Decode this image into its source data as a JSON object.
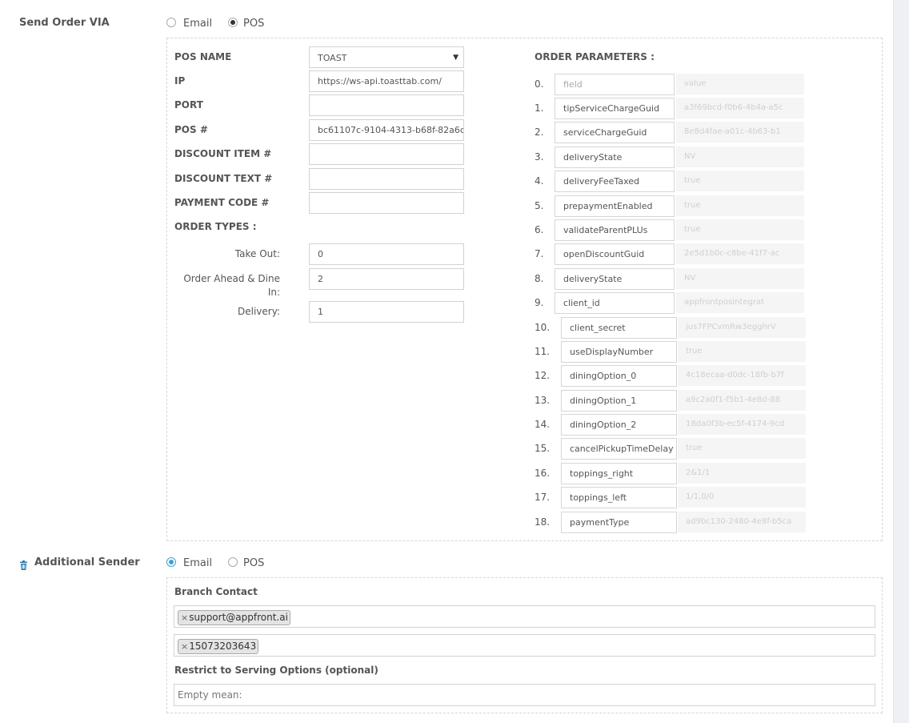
{
  "send_order": {
    "label": "Send Order VIA",
    "options": [
      "Email",
      "POS"
    ],
    "selected": "POS"
  },
  "pos": {
    "name_label": "POS NAME",
    "name_value": "TOAST",
    "ip_label": "IP",
    "ip_value": "https://ws-api.toasttab.com/",
    "port_label": "PORT",
    "port_value": "",
    "posnum_label": "POS #",
    "posnum_value": "bc61107c-9104-4313-b68f-82a6c2",
    "discount_item_label": "DISCOUNT ITEM #",
    "discount_item_value": "",
    "discount_text_label": "DISCOUNT TEXT #",
    "discount_text_value": "",
    "payment_code_label": "PAYMENT CODE #",
    "payment_code_value": ""
  },
  "order_types": {
    "label": "ORDER TYPES :",
    "take_out_label": "Take Out:",
    "take_out_value": "0",
    "order_ahead_label": "Order Ahead & Dine In:",
    "order_ahead_value": "2",
    "delivery_label": "Delivery:",
    "delivery_value": "1"
  },
  "order_parameters": {
    "label": "ORDER PARAMETERS :",
    "items": [
      {
        "num": "0.",
        "key": "field",
        "placeholder": true,
        "value": "value"
      },
      {
        "num": "1.",
        "key": "tipServiceChargeGuid",
        "value": "a3f69bcd-f0b6-4b4a-a5c"
      },
      {
        "num": "2.",
        "key": "serviceChargeGuid",
        "value": "8e8d4fae-a01c-4b63-b1"
      },
      {
        "num": "3.",
        "key": "deliveryState",
        "value": "NV"
      },
      {
        "num": "4.",
        "key": "deliveryFeeTaxed",
        "value": "true"
      },
      {
        "num": "5.",
        "key": "prepaymentEnabled",
        "value": "true"
      },
      {
        "num": "6.",
        "key": "validateParentPLUs",
        "value": "true"
      },
      {
        "num": "7.",
        "key": "openDiscountGuid",
        "value": "2e5d1b0c-c8be-41f7-ac"
      },
      {
        "num": "8.",
        "key": "deliveryState",
        "value": "NV"
      },
      {
        "num": "9.",
        "key": "client_id",
        "value": "appfrontposintegrat"
      },
      {
        "num": "10.",
        "key": "client_secret",
        "value": "jus7FPCvmRw3egghrV"
      },
      {
        "num": "11.",
        "key": "useDisplayNumber",
        "value": "true"
      },
      {
        "num": "12.",
        "key": "diningOption_0",
        "value": "4c18ecaa-d0dc-18fb-b7f"
      },
      {
        "num": "13.",
        "key": "diningOption_1",
        "value": "a9c2a0f1-f5b1-4e8d-88"
      },
      {
        "num": "14.",
        "key": "diningOption_2",
        "value": "18da0f3b-ec5f-4174-9cd"
      },
      {
        "num": "15.",
        "key": "cancelPickupTimeDelay",
        "value": "true"
      },
      {
        "num": "16.",
        "key": "toppings_right",
        "value": "2&1/1"
      },
      {
        "num": "17.",
        "key": "toppings_left",
        "value": "1/1,0/0"
      },
      {
        "num": "18.",
        "key": "paymentType",
        "value": "ad9bc130-2480-4e8f-b5ca"
      }
    ]
  },
  "additional_sender": {
    "label": "Additional Sender",
    "options": [
      "Email",
      "POS"
    ],
    "selected": "Email",
    "branch_contact_label": "Branch Contact",
    "email_tag": "support@appfront.ai",
    "phone_tag": "15073203643",
    "tag_remove": "×",
    "restrict_label": "Restrict to Serving Options (optional)",
    "restrict_placeholder": "Empty mean:"
  },
  "colors": {
    "accent": "#3aa3d6",
    "trash": "#2a7ab0"
  }
}
